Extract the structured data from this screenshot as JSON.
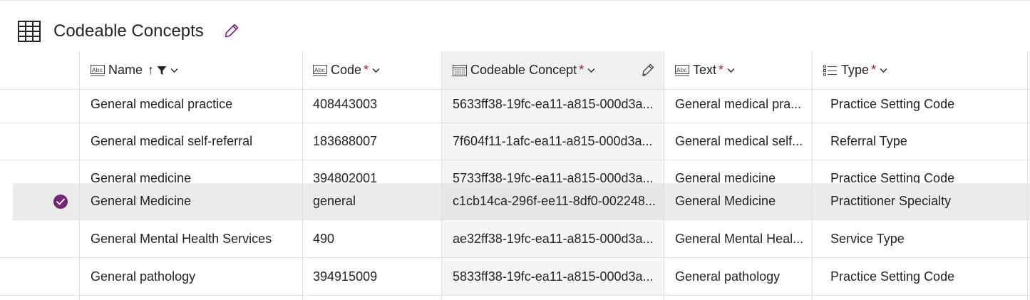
{
  "page": {
    "title": "Codeable Concepts",
    "title_icon": "table-grid-icon",
    "edit_icon": "pencil-icon"
  },
  "columns": [
    {
      "key": "name",
      "label": "Name",
      "icon": "text-field-icon",
      "sorted": "ascending",
      "filtered": true,
      "required": false
    },
    {
      "key": "code",
      "label": "Code",
      "icon": "text-field-icon",
      "required": true
    },
    {
      "key": "codeable_concept",
      "label": "Codeable Concept",
      "icon": "lookup-list-icon",
      "required": true,
      "active": true
    },
    {
      "key": "text",
      "label": "Text",
      "icon": "text-field-icon",
      "required": true
    },
    {
      "key": "type",
      "label": "Type",
      "icon": "choice-list-icon",
      "required": true
    }
  ],
  "required_marker": "*",
  "sort_arrow": "↑",
  "rows": [
    {
      "name": "General medical practice",
      "code": "408443003",
      "codeable_concept": "5633ff38-19fc-ea11-a815-000d3a...",
      "text": "General medical pra...",
      "type": "Practice Setting Code",
      "selected": false
    },
    {
      "name": "General medical self-referral",
      "code": "183688007",
      "codeable_concept": "7f604f11-1afc-ea11-a815-000d3a...",
      "text": "General medical self...",
      "type": "Referral Type",
      "selected": false
    },
    {
      "name": "General medicine",
      "code": "394802001",
      "codeable_concept": "5733ff38-19fc-ea11-a815-000d3a...",
      "text": "General medicine",
      "type": "Practice Setting Code",
      "selected": false
    },
    {
      "name": "General Medicine",
      "code": "general",
      "codeable_concept": "c1cb14ca-296f-ee11-8df0-002248...",
      "text": "General Medicine",
      "type": "Practitioner Specialty",
      "selected": true
    },
    {
      "name": "General Mental Health Services",
      "code": "490",
      "codeable_concept": "ae32ff38-19fc-ea11-a815-000d3a...",
      "text": "General Mental Heal...",
      "type": "Service Type",
      "selected": false
    },
    {
      "name": "General pathology",
      "code": "394915009",
      "codeable_concept": "5833ff38-19fc-ea11-a815-000d3a...",
      "text": "General pathology",
      "type": "Practice Setting Code",
      "selected": false
    }
  ],
  "colors": {
    "accent": "#742774",
    "required": "#a4262c",
    "selected_row": "#ebebeb",
    "active_column": "#f0f0f0"
  }
}
